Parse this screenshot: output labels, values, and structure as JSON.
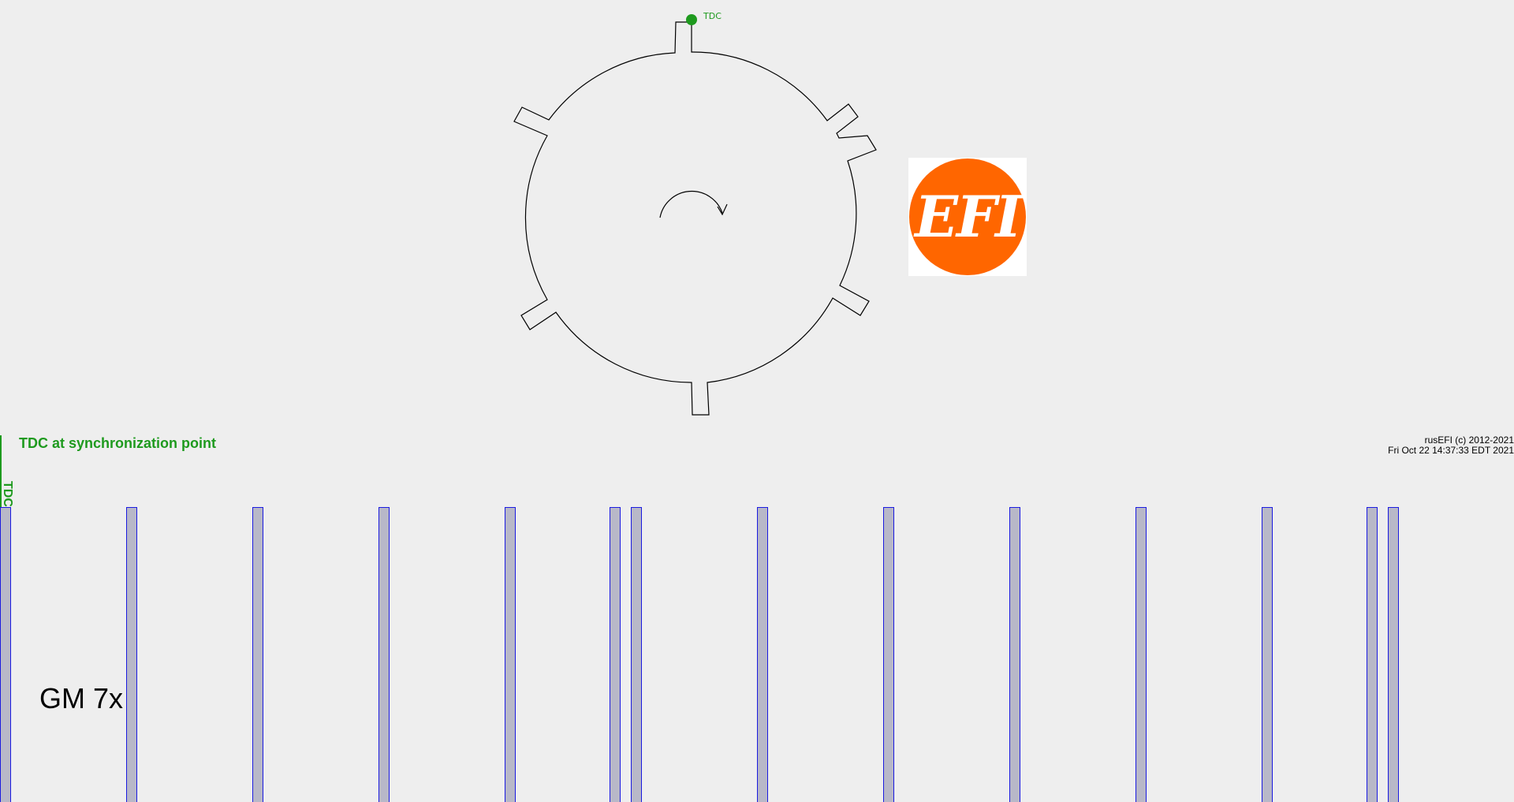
{
  "wheel": {
    "tdc_label": "TDC"
  },
  "logo": {
    "text": "EFI"
  },
  "diagram": {
    "sync_caption": "TDC at synchronization point",
    "tdc_marker_label": "TDC",
    "trigger_name": "GM 7x",
    "copyright_line1": "rusEFI (c) 2012-2021",
    "copyright_line2": "Fri Oct 22 14:37:33 EDT 2021"
  },
  "teeth_count": 14,
  "colors": {
    "tdc_green": "#1e9a1e",
    "tooth_fill": "#b8b8c8",
    "tooth_border": "#1a1ae0",
    "logo_orange": "#ff6600"
  }
}
